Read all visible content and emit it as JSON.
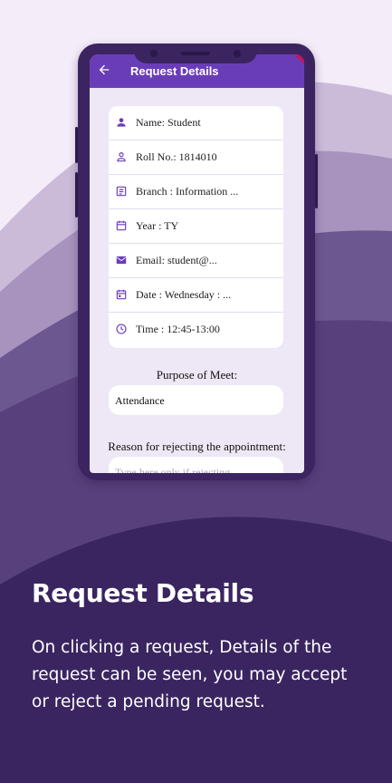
{
  "app_bar": {
    "title": "Request Details",
    "back_icon": "arrow-left-icon"
  },
  "details": [
    {
      "icon": "person-filled-icon",
      "text": "Name: Student"
    },
    {
      "icon": "person-outline-icon",
      "text": "Roll No.: 1814010"
    },
    {
      "icon": "notes-icon",
      "text": "Branch : Information ..."
    },
    {
      "icon": "calendar-outline-icon",
      "text": "Year : TY"
    },
    {
      "icon": "mail-icon",
      "text": "Email: student@..."
    },
    {
      "icon": "calendar-event-icon",
      "text": "Date : Wednesday : ..."
    },
    {
      "icon": "clock-icon",
      "text": "Time : 12:45-13:00"
    }
  ],
  "purpose": {
    "label": "Purpose of Meet:",
    "value": "Attendance"
  },
  "reject": {
    "label": "Reason for rejecting the appointment:",
    "placeholder": "Type here only if rejecting"
  },
  "caption": {
    "title": "Request Details",
    "body": "On clicking a request, Details of the request can be seen, you may accept or reject a pending request."
  },
  "colors": {
    "primary": "#6a3db8",
    "phone_frame": "#3c2461",
    "background_dark": "#3a2560",
    "background_light": "#f4ecf9"
  }
}
